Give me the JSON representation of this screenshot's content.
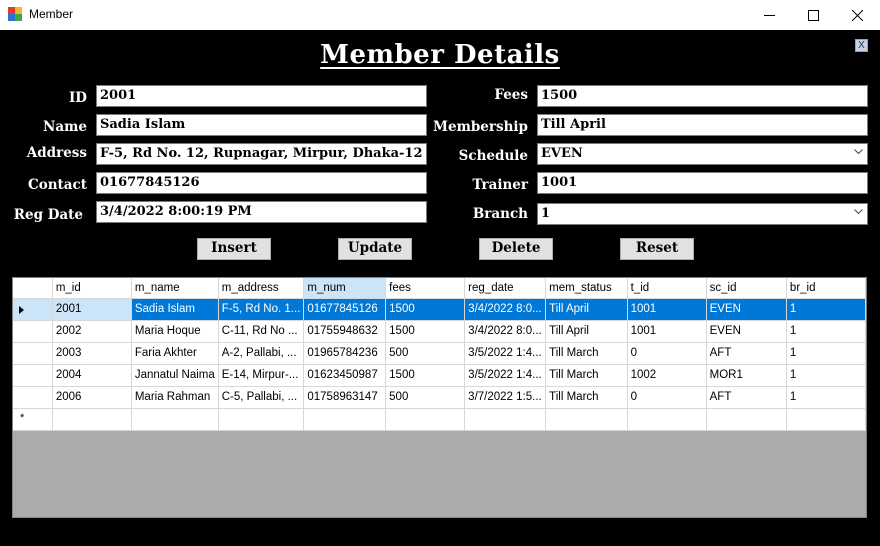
{
  "window": {
    "title": "Member"
  },
  "form": {
    "heading": "Member Details",
    "close_label": "X",
    "labels": {
      "id": "ID",
      "name": "Name",
      "address": "Address",
      "contact": "Contact",
      "reg_date": "Reg Date",
      "fees": "Fees",
      "membership": "Membership",
      "schedule": "Schedule",
      "trainer": "Trainer",
      "branch": "Branch"
    },
    "values": {
      "id": "2001",
      "name": "Sadia Islam",
      "address": "F-5, Rd No. 12, Rupnagar, Mirpur, Dhaka-12",
      "contact": "01677845126",
      "reg_date": "3/4/2022 8:00:19 PM",
      "fees": "1500",
      "membership": "Till April",
      "schedule": "EVEN",
      "trainer": "1001",
      "branch": "1"
    },
    "buttons": {
      "insert": "Insert",
      "update": "Update",
      "delete": "Delete",
      "reset": "Reset"
    }
  },
  "grid": {
    "columns": [
      "m_id",
      "m_name",
      "m_address",
      "m_num",
      "fees",
      "reg_date",
      "mem_status",
      "t_id",
      "sc_id",
      "br_id"
    ],
    "sorted_column": "m_num",
    "rows": [
      [
        "2001",
        "Sadia Islam",
        "F-5, Rd No. 1...",
        "01677845126",
        "1500",
        "3/4/2022 8:0...",
        "Till April",
        "1001",
        "EVEN",
        "1"
      ],
      [
        "2002",
        "Maria Hoque",
        "C-11, Rd No ...",
        "01755948632",
        "1500",
        "3/4/2022 8:0...",
        "Till April",
        "1001",
        "EVEN",
        "1"
      ],
      [
        "2003",
        "Faria Akhter",
        "A-2, Pallabi, ...",
        "01965784236",
        "500",
        "3/5/2022 1:4...",
        "Till March",
        "0",
        "AFT",
        "1"
      ],
      [
        "2004",
        "Jannatul Naima",
        "E-14, Mirpur-...",
        "01623450987",
        "1500",
        "3/5/2022 1:4...",
        "Till March",
        "1002",
        "MOR1",
        "1"
      ],
      [
        "2006",
        "Maria Rahman",
        "C-5, Pallabi, ...",
        "01758963147",
        "500",
        "3/7/2022 1:5...",
        "Till March",
        "0",
        "AFT",
        "1"
      ]
    ],
    "selected_row": 0,
    "new_row_marker": "*"
  }
}
